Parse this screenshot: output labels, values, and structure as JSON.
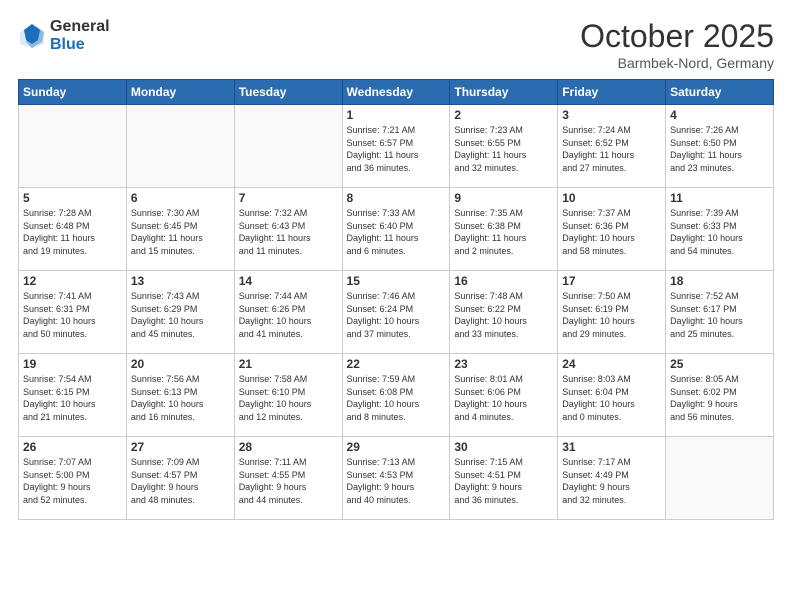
{
  "logo": {
    "general": "General",
    "blue": "Blue"
  },
  "header": {
    "month": "October 2025",
    "location": "Barmbek-Nord, Germany"
  },
  "weekdays": [
    "Sunday",
    "Monday",
    "Tuesday",
    "Wednesday",
    "Thursday",
    "Friday",
    "Saturday"
  ],
  "weeks": [
    [
      {
        "day": "",
        "info": ""
      },
      {
        "day": "",
        "info": ""
      },
      {
        "day": "",
        "info": ""
      },
      {
        "day": "1",
        "info": "Sunrise: 7:21 AM\nSunset: 6:57 PM\nDaylight: 11 hours\nand 36 minutes."
      },
      {
        "day": "2",
        "info": "Sunrise: 7:23 AM\nSunset: 6:55 PM\nDaylight: 11 hours\nand 32 minutes."
      },
      {
        "day": "3",
        "info": "Sunrise: 7:24 AM\nSunset: 6:52 PM\nDaylight: 11 hours\nand 27 minutes."
      },
      {
        "day": "4",
        "info": "Sunrise: 7:26 AM\nSunset: 6:50 PM\nDaylight: 11 hours\nand 23 minutes."
      }
    ],
    [
      {
        "day": "5",
        "info": "Sunrise: 7:28 AM\nSunset: 6:48 PM\nDaylight: 11 hours\nand 19 minutes."
      },
      {
        "day": "6",
        "info": "Sunrise: 7:30 AM\nSunset: 6:45 PM\nDaylight: 11 hours\nand 15 minutes."
      },
      {
        "day": "7",
        "info": "Sunrise: 7:32 AM\nSunset: 6:43 PM\nDaylight: 11 hours\nand 11 minutes."
      },
      {
        "day": "8",
        "info": "Sunrise: 7:33 AM\nSunset: 6:40 PM\nDaylight: 11 hours\nand 6 minutes."
      },
      {
        "day": "9",
        "info": "Sunrise: 7:35 AM\nSunset: 6:38 PM\nDaylight: 11 hours\nand 2 minutes."
      },
      {
        "day": "10",
        "info": "Sunrise: 7:37 AM\nSunset: 6:36 PM\nDaylight: 10 hours\nand 58 minutes."
      },
      {
        "day": "11",
        "info": "Sunrise: 7:39 AM\nSunset: 6:33 PM\nDaylight: 10 hours\nand 54 minutes."
      }
    ],
    [
      {
        "day": "12",
        "info": "Sunrise: 7:41 AM\nSunset: 6:31 PM\nDaylight: 10 hours\nand 50 minutes."
      },
      {
        "day": "13",
        "info": "Sunrise: 7:43 AM\nSunset: 6:29 PM\nDaylight: 10 hours\nand 45 minutes."
      },
      {
        "day": "14",
        "info": "Sunrise: 7:44 AM\nSunset: 6:26 PM\nDaylight: 10 hours\nand 41 minutes."
      },
      {
        "day": "15",
        "info": "Sunrise: 7:46 AM\nSunset: 6:24 PM\nDaylight: 10 hours\nand 37 minutes."
      },
      {
        "day": "16",
        "info": "Sunrise: 7:48 AM\nSunset: 6:22 PM\nDaylight: 10 hours\nand 33 minutes."
      },
      {
        "day": "17",
        "info": "Sunrise: 7:50 AM\nSunset: 6:19 PM\nDaylight: 10 hours\nand 29 minutes."
      },
      {
        "day": "18",
        "info": "Sunrise: 7:52 AM\nSunset: 6:17 PM\nDaylight: 10 hours\nand 25 minutes."
      }
    ],
    [
      {
        "day": "19",
        "info": "Sunrise: 7:54 AM\nSunset: 6:15 PM\nDaylight: 10 hours\nand 21 minutes."
      },
      {
        "day": "20",
        "info": "Sunrise: 7:56 AM\nSunset: 6:13 PM\nDaylight: 10 hours\nand 16 minutes."
      },
      {
        "day": "21",
        "info": "Sunrise: 7:58 AM\nSunset: 6:10 PM\nDaylight: 10 hours\nand 12 minutes."
      },
      {
        "day": "22",
        "info": "Sunrise: 7:59 AM\nSunset: 6:08 PM\nDaylight: 10 hours\nand 8 minutes."
      },
      {
        "day": "23",
        "info": "Sunrise: 8:01 AM\nSunset: 6:06 PM\nDaylight: 10 hours\nand 4 minutes."
      },
      {
        "day": "24",
        "info": "Sunrise: 8:03 AM\nSunset: 6:04 PM\nDaylight: 10 hours\nand 0 minutes."
      },
      {
        "day": "25",
        "info": "Sunrise: 8:05 AM\nSunset: 6:02 PM\nDaylight: 9 hours\nand 56 minutes."
      }
    ],
    [
      {
        "day": "26",
        "info": "Sunrise: 7:07 AM\nSunset: 5:00 PM\nDaylight: 9 hours\nand 52 minutes."
      },
      {
        "day": "27",
        "info": "Sunrise: 7:09 AM\nSunset: 4:57 PM\nDaylight: 9 hours\nand 48 minutes."
      },
      {
        "day": "28",
        "info": "Sunrise: 7:11 AM\nSunset: 4:55 PM\nDaylight: 9 hours\nand 44 minutes."
      },
      {
        "day": "29",
        "info": "Sunrise: 7:13 AM\nSunset: 4:53 PM\nDaylight: 9 hours\nand 40 minutes."
      },
      {
        "day": "30",
        "info": "Sunrise: 7:15 AM\nSunset: 4:51 PM\nDaylight: 9 hours\nand 36 minutes."
      },
      {
        "day": "31",
        "info": "Sunrise: 7:17 AM\nSunset: 4:49 PM\nDaylight: 9 hours\nand 32 minutes."
      },
      {
        "day": "",
        "info": ""
      }
    ]
  ]
}
